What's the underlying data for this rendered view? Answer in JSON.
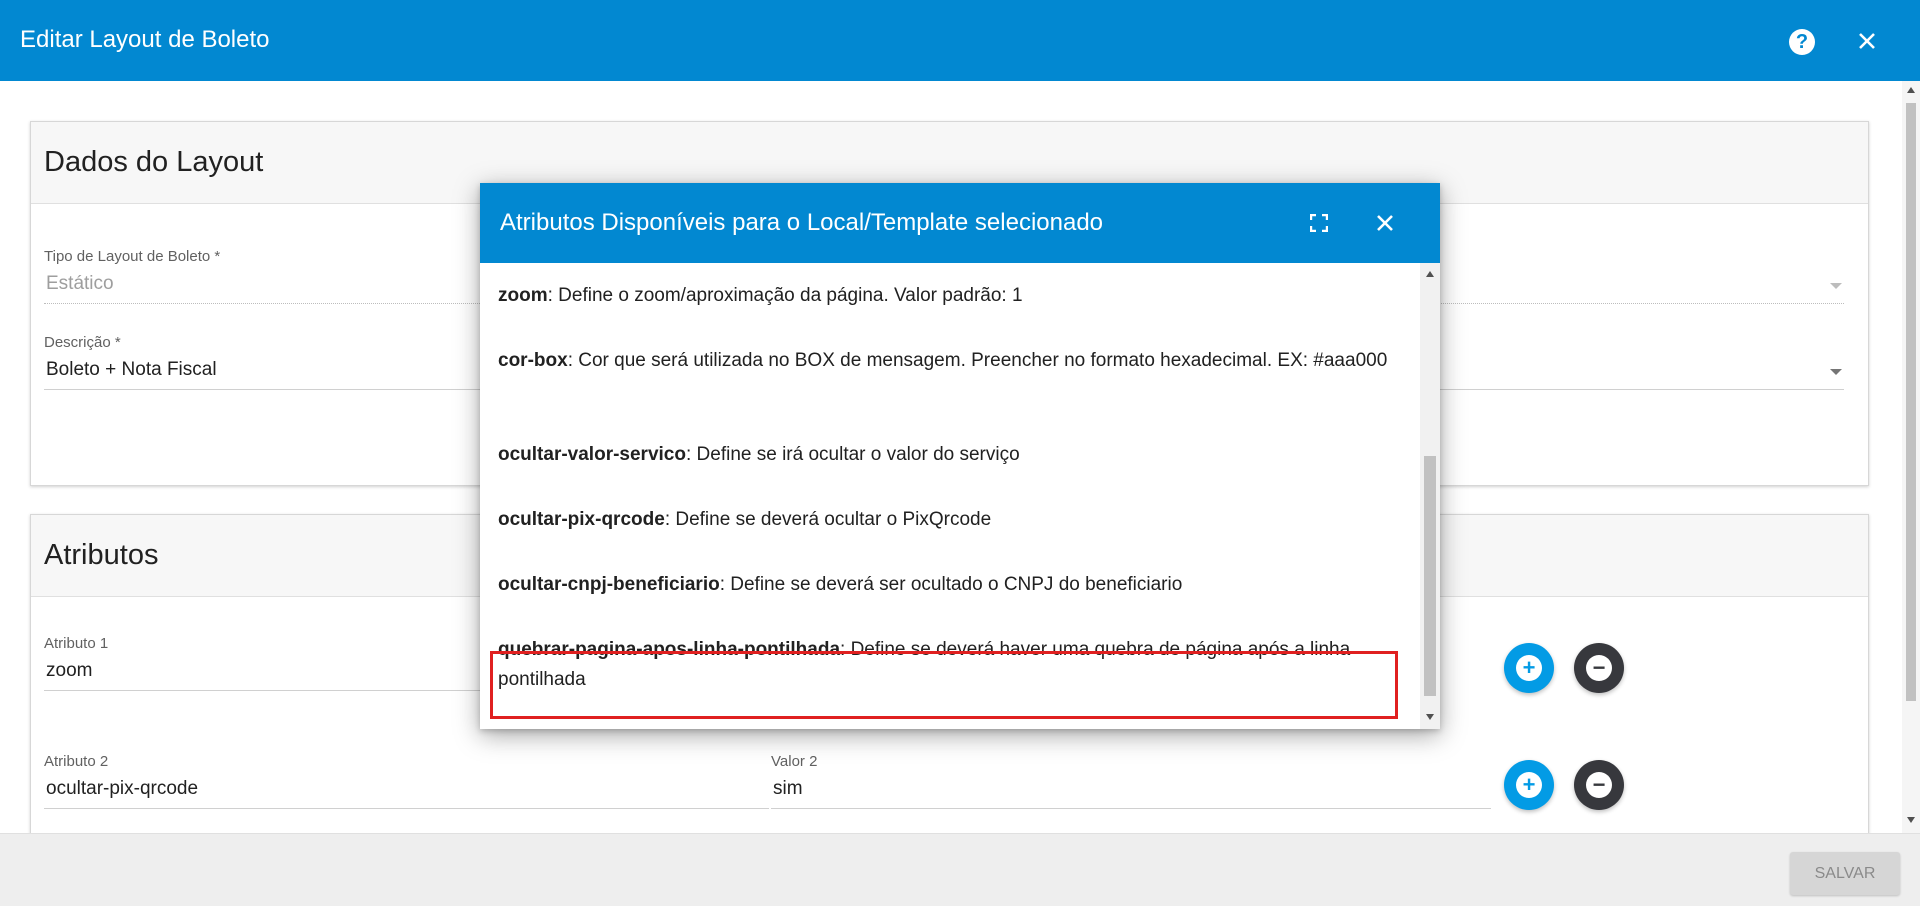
{
  "header": {
    "title": "Editar Layout de Boleto",
    "help_icon": "help-circle-icon",
    "close_icon": "close-icon",
    "color": "#0288d1"
  },
  "dados_panel": {
    "title": "Dados do Layout",
    "tipo_label": "Tipo de Layout de Boleto *",
    "tipo_value": "Estático",
    "descricao_label": "Descrição *",
    "descricao_value": "Boleto + Nota Fiscal"
  },
  "atributos_panel": {
    "title": "Atributos",
    "rows": [
      {
        "attr_label": "Atributo 1",
        "attr_value": "zoom",
        "valor_label": "",
        "valor_value": ""
      },
      {
        "attr_label": "Atributo 2",
        "attr_value": "ocultar-pix-qrcode",
        "valor_label": "Valor 2",
        "valor_value": "sim"
      }
    ],
    "add_icon": "plus-circle-icon",
    "remove_icon": "minus-circle-icon"
  },
  "footer": {
    "save_label": "SALVAR"
  },
  "modal": {
    "title": "Atributos Disponíveis para o Local/Template selecionado",
    "expand_icon": "fullscreen-icon",
    "close_icon": "close-icon",
    "items": [
      {
        "name": "zoom",
        "desc": ": Define o zoom/aproximação da página. Valor padrão: 1"
      },
      {
        "name": "cor-box",
        "desc": ": Cor que será utilizada no BOX de mensagem. Preencher no formato hexadecimal. EX: #aaa000"
      },
      {
        "name": "ocultar-valor-servico",
        "desc": ": Define se irá ocultar o valor do serviço"
      },
      {
        "name": "ocultar-pix-qrcode",
        "desc": ": Define se deverá ocultar o PixQrcode"
      },
      {
        "name": "ocultar-cnpj-beneficiario",
        "desc": ": Define se deverá ser ocultado o CNPJ do beneficiario"
      },
      {
        "name": "quebrar-pagina-apos-linha-pontilhada",
        "desc": ": Define se deverá haver uma quebra de página após a linha pontilhada"
      }
    ],
    "highlight_color": "#e02020"
  }
}
